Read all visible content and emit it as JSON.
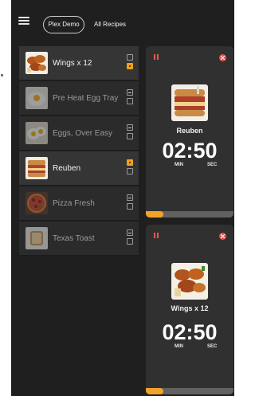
{
  "header": {
    "menu_icon": "hamburger-menu-icon",
    "workspace_label": "Plex Demo",
    "all_recipes_label": "All Recipes"
  },
  "colors": {
    "accent_orange": "#f0a020",
    "alert_red": "#e8504a",
    "background": "#1f1f1f",
    "row": "#2b2b2b",
    "panel": "#303030"
  },
  "recipes": [
    {
      "name": "Wings x 12",
      "image": "wings-icon",
      "state": "active-top",
      "checks": [
        "empty",
        "orange"
      ]
    },
    {
      "name": "Pre Heat Egg Tray",
      "image": "egg-tray-icon",
      "state": "dim",
      "checks": [
        "dash",
        "empty"
      ]
    },
    {
      "name": "Eggs, Over Easy",
      "image": "eggs-icon",
      "state": "dim",
      "checks": [
        "dash",
        "empty"
      ]
    },
    {
      "name": "Reuben",
      "image": "sandwich-icon",
      "state": "active",
      "checks": [
        "orange",
        "empty"
      ]
    },
    {
      "name": "Pizza  Fresh",
      "image": "pizza-icon",
      "state": "dim",
      "checks": [
        "dash",
        "empty"
      ]
    },
    {
      "name": "Texas Toast",
      "image": "toast-icon",
      "state": "dim",
      "checks": [
        "dash",
        "empty"
      ]
    }
  ],
  "timers": [
    {
      "name": "Reuben",
      "image": "sandwich-icon",
      "time": "02:50",
      "min_label": "MIN",
      "sec_label": "SEC",
      "progress": 0.2
    },
    {
      "name": "Wings x 12",
      "image": "wings-icon",
      "time": "02:50",
      "min_label": "MIN",
      "sec_label": "SEC",
      "progress": 0.2
    }
  ]
}
